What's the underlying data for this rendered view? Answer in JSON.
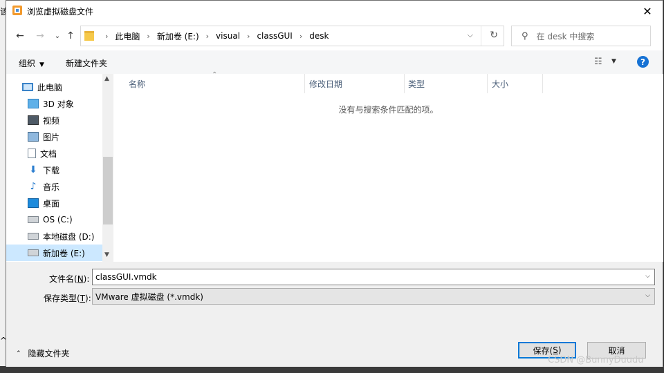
{
  "window": {
    "title": "浏览虚拟磁盘文件"
  },
  "navigation": {
    "breadcrumb": [
      "此电脑",
      "新加卷 (E:)",
      "visual",
      "classGUI",
      "desk"
    ],
    "search_placeholder": "在 desk 中搜索"
  },
  "toolbar": {
    "organize": "组织",
    "new_folder": "新建文件夹"
  },
  "sidebar": {
    "items": [
      {
        "label": "此电脑",
        "icon": "computer-icon"
      },
      {
        "label": "3D 对象",
        "icon": "3d-objects-icon"
      },
      {
        "label": "视频",
        "icon": "video-icon"
      },
      {
        "label": "图片",
        "icon": "pictures-icon"
      },
      {
        "label": "文档",
        "icon": "documents-icon"
      },
      {
        "label": "下载",
        "icon": "download-icon"
      },
      {
        "label": "音乐",
        "icon": "music-icon"
      },
      {
        "label": "桌面",
        "icon": "desktop-icon"
      },
      {
        "label": "OS (C:)",
        "icon": "drive-icon"
      },
      {
        "label": "本地磁盘 (D:)",
        "icon": "drive-icon"
      },
      {
        "label": "新加卷 (E:)",
        "icon": "drive-icon",
        "selected": true
      }
    ]
  },
  "file_list": {
    "columns": [
      "名称",
      "修改日期",
      "类型",
      "大小"
    ],
    "empty_message": "没有与搜索条件匹配的项。"
  },
  "footer": {
    "filename_label": "文件名(",
    "filename_key": "N",
    "filename_label_end": "):",
    "filename_value": "classGUI.vmdk",
    "filetype_label": "保存类型(",
    "filetype_key": "T",
    "filetype_label_end": "):",
    "filetype_value": "VMware 虚拟磁盘 (*.vmdk)",
    "hide_folders": "隐藏文件夹",
    "save_label": "保存(",
    "save_key": "S",
    "save_label_end": ")",
    "cancel_label": "取消"
  },
  "background": {
    "left_glyph_top": "该",
    "left_glyph_bottom": "^",
    "watermark": "CSDN @BunnyDuudu"
  },
  "colors": {
    "accent": "#0078d7",
    "selection": "#cce8ff",
    "help": "#1672d4"
  }
}
